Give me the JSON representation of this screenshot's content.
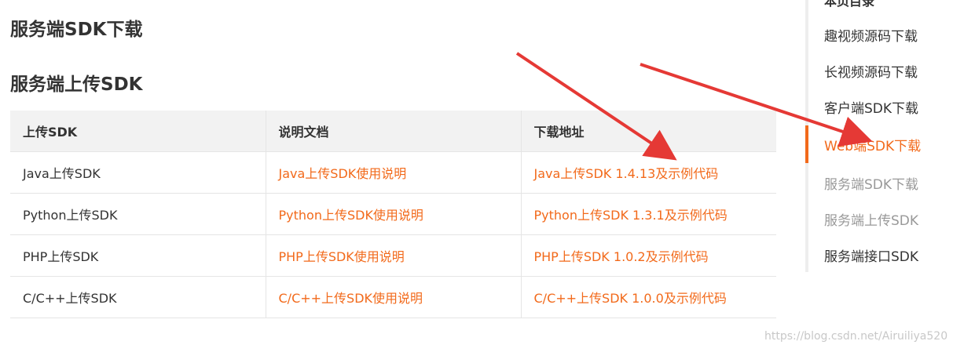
{
  "headings": {
    "main": "服务端SDK下载",
    "sub": "服务端上传SDK"
  },
  "table": {
    "headers": [
      "上传SDK",
      "说明文档",
      "下载地址"
    ],
    "rows": [
      [
        "Java上传SDK",
        "Java上传SDK使用说明",
        "Java上传SDK 1.4.13及示例代码"
      ],
      [
        "Python上传SDK",
        "Python上传SDK使用说明",
        "Python上传SDK 1.3.1及示例代码"
      ],
      [
        "PHP上传SDK",
        "PHP上传SDK使用说明",
        "PHP上传SDK 1.0.2及示例代码"
      ],
      [
        "C/C++上传SDK",
        "C/C++上传SDK使用说明",
        "C/C++上传SDK 1.0.0及示例代码"
      ]
    ]
  },
  "toc": {
    "title": "本页目录",
    "items": [
      {
        "label": "趣视频源码下载",
        "state": "normal"
      },
      {
        "label": "长视频源码下载",
        "state": "normal"
      },
      {
        "label": "客户端SDK下载",
        "state": "normal"
      },
      {
        "label": "Web端SDK下载",
        "state": "active"
      },
      {
        "label": "服务端SDK下载",
        "state": "muted"
      },
      {
        "label": "服务端上传SDK",
        "state": "muted"
      },
      {
        "label": "服务端接口SDK",
        "state": "normal"
      }
    ]
  },
  "watermark": "https://blog.csdn.net/Airuiliya520",
  "colors": {
    "link": "#f26a1b",
    "annotation_arrow": "#e53935"
  }
}
